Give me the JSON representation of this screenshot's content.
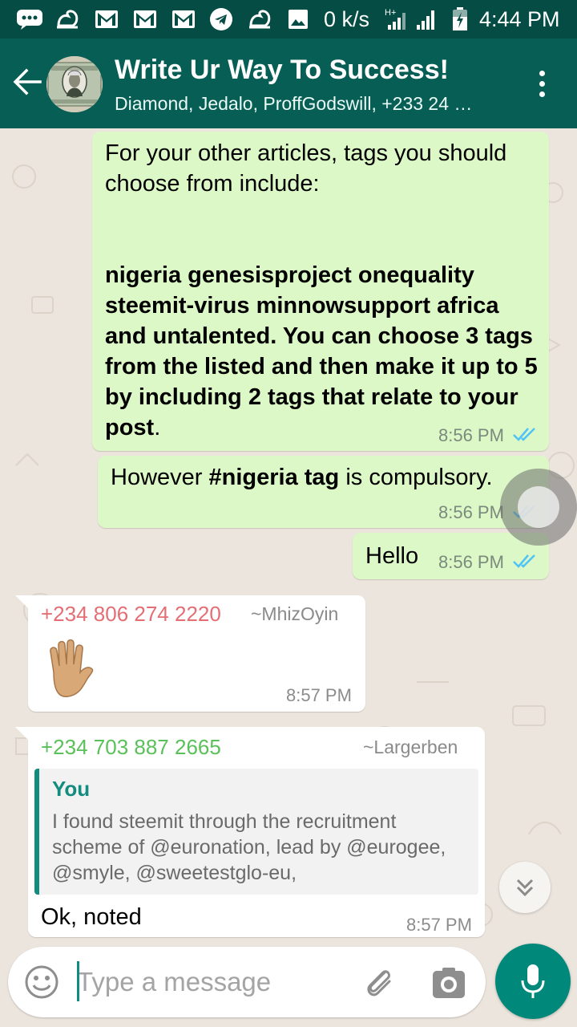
{
  "status_bar": {
    "net_speed": "0 k/s",
    "network_type": "H+",
    "time": "4:44 PM",
    "icons": [
      "chat-bubble-icon",
      "uc-browser-icon",
      "gmail-icon",
      "gmail-icon",
      "gmail-icon",
      "telegram-icon",
      "uc-browser-icon",
      "image-icon",
      "signal-icon",
      "battery-icon"
    ]
  },
  "header": {
    "title": "Write Ur Way To Success!",
    "members": "Diamond, Jedalo, ProffGodswill, +233 24 …",
    "back_icon": "arrow-left-icon",
    "menu_icon": "more-vertical-icon",
    "avatar": "dollar-bill-avatar"
  },
  "messages": [
    {
      "direction": "out",
      "text_plain": "For your other articles, tags you should choose from include:",
      "text_bold": "nigeria genesisproject onequality steemit-virus minnowsupport africa and untalented. You can choose 3 tags from the listed and then make it up to 5 by including 2 tags that relate to your post",
      "text_tail": ".",
      "time": "8:56 PM",
      "status": "read"
    },
    {
      "direction": "out",
      "text_pre": "However ",
      "text_bold": "#nigeria tag",
      "text_post": " is compulsory.",
      "time": "8:56 PM",
      "status": "read"
    },
    {
      "direction": "out",
      "text": "Hello",
      "time": "8:56 PM",
      "status": "read"
    },
    {
      "direction": "in",
      "sender_phone": "+234 806 274 2220",
      "sender_name": "~MhizOyin",
      "sender_color": "#e36f75",
      "emoji": "✋🏽",
      "time": "8:57 PM"
    },
    {
      "direction": "in",
      "sender_phone": "+234 703 887 2665",
      "sender_name": "~Largerben",
      "sender_color": "#5ac05a",
      "quote": {
        "author": "You",
        "text": "I found steemit through the recruitment scheme of @euronation, lead by @eurogee, @smyle, @sweetestglo-eu,"
      },
      "text": "Ok, noted",
      "time": "8:57 PM"
    }
  ],
  "composer": {
    "placeholder": "Type a message",
    "emoji_icon": "smiley-icon",
    "attach_icon": "paperclip-icon",
    "camera_icon": "camera-icon",
    "mic_icon": "microphone-icon"
  },
  "scroll_icon": "double-chevron-down-icon",
  "colors": {
    "header": "#075e54",
    "status_bar": "#054d44",
    "outgoing_bubble": "#dcf8c6",
    "incoming_bubble": "#ffffff",
    "read_ticks": "#4fc3f7",
    "accent": "#00897b",
    "background": "#ece5dd"
  }
}
